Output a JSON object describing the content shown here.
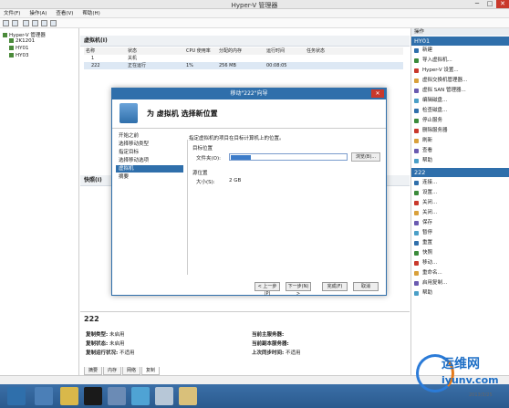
{
  "window": {
    "title": "Hyper-V 管理器",
    "min": "─",
    "max": "□",
    "close": "✕"
  },
  "menu": [
    "文件(F)",
    "操作(A)",
    "查看(V)",
    "帮助(H)"
  ],
  "tree": {
    "root": "Hyper-V 管理器",
    "items": [
      "2K1201",
      "HY01",
      "HY03"
    ]
  },
  "vms": {
    "title": "虚拟机(I)",
    "columns": [
      "名称",
      "状态",
      "CPU 使用率",
      "分配的内存",
      "运行时间",
      "任务状态"
    ],
    "rows": [
      [
        "1",
        "关机",
        "",
        "",
        "",
        ""
      ],
      [
        "222",
        "正在运行",
        "1%",
        "256 MB",
        "00:08:05",
        ""
      ]
    ]
  },
  "snapshots": {
    "title": "快照(I)"
  },
  "dialog": {
    "title": "移动\"222\"向导",
    "close": "✕",
    "heading": "为 虚拟机 选择新位置",
    "steps": [
      "开始之前",
      "选择移动类型",
      "指定目标",
      "选择移动选项",
      "虚拟机",
      "摘要"
    ],
    "active_step": 4,
    "instruction": "指定虚拟机的项目在目标计算机上的位置。",
    "target_label": "目标位置",
    "folder_label": "文件夹(O):",
    "browse": "浏览(B)...",
    "source_label": "源位置",
    "size_label": "大小(S):",
    "size_value": "2 GB",
    "buttons": [
      "< 上一步(P)",
      "下一步(N) >",
      "完成(F)",
      "取消"
    ]
  },
  "details": {
    "title": "222",
    "left": [
      {
        "k": "复制类型:",
        "v": "未启用"
      },
      {
        "k": "复制状态:",
        "v": "未启用"
      },
      {
        "k": "复制运行状况:",
        "v": "不适用"
      }
    ],
    "right": [
      {
        "k": "当前主服务器:",
        "v": ""
      },
      {
        "k": "当前副本服务器:",
        "v": ""
      },
      {
        "k": "上次同步时间:",
        "v": "不适用"
      }
    ],
    "tabs": [
      "摘要",
      "内存",
      "网络",
      "复制"
    ]
  },
  "actions": {
    "header": "操作",
    "host": "HY01",
    "host_items": [
      "新建",
      "导入虚拟机...",
      "Hyper-V 设置...",
      "虚拟交换机管理器...",
      "虚拟 SAN 管理器...",
      "编辑磁盘...",
      "检查磁盘...",
      "停止服务",
      "删除服务器",
      "刷新",
      "查看",
      "帮助"
    ],
    "vm": "222",
    "vm_items": [
      "连接...",
      "设置...",
      "关闭...",
      "关闭...",
      "保存",
      "暂停",
      "重置",
      "快照",
      "移动...",
      "重命名...",
      "启用复制...",
      "帮助"
    ]
  },
  "watermark": {
    "cn": "运维网",
    "en": "iyunv.com",
    "date": "2013/3/25"
  },
  "colors": {
    "accent": "#2f6fab",
    "task": "#2a5a8e"
  }
}
